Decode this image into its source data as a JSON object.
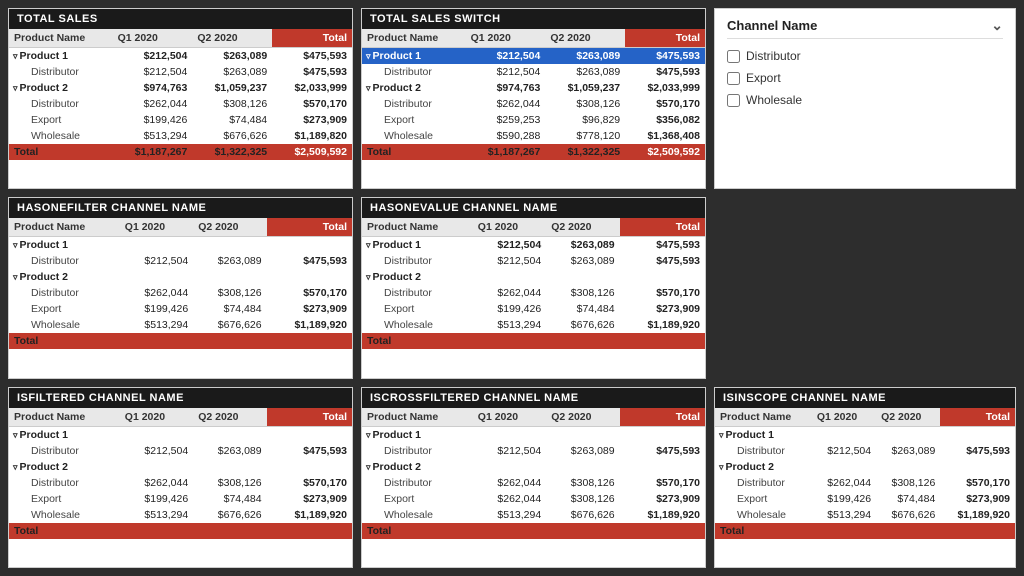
{
  "tables": {
    "totalSales": {
      "title": "TOTAL SALES",
      "columns": [
        "Product Name",
        "Q1 2020",
        "Q2 2020",
        "Total"
      ],
      "rows": [
        {
          "type": "product",
          "name": "Product 1",
          "q1": "$212,504",
          "q2": "$263,089",
          "total": "$475,593"
        },
        {
          "type": "child",
          "name": "Distributor",
          "q1": "$212,504",
          "q2": "$263,089",
          "total": "$475,593"
        },
        {
          "type": "product",
          "name": "Product 2",
          "q1": "$974,763",
          "q2": "$1,059,237",
          "total": "$2,033,999"
        },
        {
          "type": "child",
          "name": "Distributor",
          "q1": "$262,044",
          "q2": "$308,126",
          "total": "$570,170"
        },
        {
          "type": "child",
          "name": "Export",
          "q1": "$199,426",
          "q2": "$74,484",
          "total": "$273,909"
        },
        {
          "type": "child",
          "name": "Wholesale",
          "q1": "$513,294",
          "q2": "$676,626",
          "total": "$1,189,820"
        },
        {
          "type": "total",
          "name": "Total",
          "q1": "$1,187,267",
          "q2": "$1,322,325",
          "total": "$2,509,592"
        }
      ]
    },
    "totalSalesSwitch": {
      "title": "TOTAL SALES SWITCH",
      "columns": [
        "Product Name",
        "Q1 2020",
        "Q2 2020",
        "Total"
      ],
      "highlightRow": 0,
      "rows": [
        {
          "type": "product",
          "name": "Product 1",
          "q1": "$212,504",
          "q2": "$263,089",
          "total": "$475,593",
          "highlight": true
        },
        {
          "type": "child",
          "name": "Distributor",
          "q1": "$212,504",
          "q2": "$263,089",
          "total": "$475,593"
        },
        {
          "type": "product",
          "name": "Product 2",
          "q1": "$974,763",
          "q2": "$1,059,237",
          "total": "$2,033,999"
        },
        {
          "type": "child",
          "name": "Distributor",
          "q1": "$262,044",
          "q2": "$308,126",
          "total": "$570,170"
        },
        {
          "type": "child",
          "name": "Export",
          "q1": "$259,253",
          "q2": "$96,829",
          "total": "$356,082"
        },
        {
          "type": "child",
          "name": "Wholesale",
          "q1": "$590,288",
          "q2": "$778,120",
          "total": "$1,368,408"
        },
        {
          "type": "total",
          "name": "Total",
          "q1": "$1,187,267",
          "q2": "$1,322,325",
          "total": "$2,509,592"
        }
      ]
    },
    "hasOneFilter": {
      "title": "HASONEFILTER CHANNEL NAME",
      "columns": [
        "Product Name",
        "Q1 2020",
        "Q2 2020",
        "Total"
      ],
      "rows": [
        {
          "type": "product",
          "name": "Product 1",
          "q1": "",
          "q2": "",
          "total": ""
        },
        {
          "type": "child",
          "name": "Distributor",
          "q1": "$212,504",
          "q2": "$263,089",
          "total": "$475,593"
        },
        {
          "type": "product",
          "name": "Product 2",
          "q1": "",
          "q2": "",
          "total": ""
        },
        {
          "type": "child",
          "name": "Distributor",
          "q1": "$262,044",
          "q2": "$308,126",
          "total": "$570,170"
        },
        {
          "type": "child",
          "name": "Export",
          "q1": "$199,426",
          "q2": "$74,484",
          "total": "$273,909"
        },
        {
          "type": "child",
          "name": "Wholesale",
          "q1": "$513,294",
          "q2": "$676,626",
          "total": "$1,189,920"
        },
        {
          "type": "total",
          "name": "Total",
          "q1": "",
          "q2": "",
          "total": ""
        }
      ]
    },
    "hasOneValue": {
      "title": "HASONEVALUE CHANNEL NAME",
      "columns": [
        "Product Name",
        "Q1 2020",
        "Q2 2020",
        "Total"
      ],
      "rows": [
        {
          "type": "product",
          "name": "Product 1",
          "q1": "$212,504",
          "q2": "$263,089",
          "total": "$475,593"
        },
        {
          "type": "child",
          "name": "Distributor",
          "q1": "$212,504",
          "q2": "$263,089",
          "total": "$475,593"
        },
        {
          "type": "product",
          "name": "Product 2",
          "q1": "",
          "q2": "",
          "total": ""
        },
        {
          "type": "child",
          "name": "Distributor",
          "q1": "$262,044",
          "q2": "$308,126",
          "total": "$570,170"
        },
        {
          "type": "child",
          "name": "Export",
          "q1": "$199,426",
          "q2": "$74,484",
          "total": "$273,909"
        },
        {
          "type": "child",
          "name": "Wholesale",
          "q1": "$513,294",
          "q2": "$676,626",
          "total": "$1,189,920"
        },
        {
          "type": "total",
          "name": "Total",
          "q1": "",
          "q2": "",
          "total": ""
        }
      ]
    },
    "isFiltered": {
      "title": "ISFILTERED CHANNEL NAME",
      "columns": [
        "Product Name",
        "Q1 2020",
        "Q2 2020",
        "Total"
      ],
      "rows": [
        {
          "type": "product",
          "name": "Product 1",
          "q1": "",
          "q2": "",
          "total": ""
        },
        {
          "type": "child",
          "name": "Distributor",
          "q1": "$212,504",
          "q2": "$263,089",
          "total": "$475,593"
        },
        {
          "type": "product",
          "name": "Product 2",
          "q1": "",
          "q2": "",
          "total": ""
        },
        {
          "type": "child",
          "name": "Distributor",
          "q1": "$262,044",
          "q2": "$308,126",
          "total": "$570,170"
        },
        {
          "type": "child",
          "name": "Export",
          "q1": "$199,426",
          "q2": "$74,484",
          "total": "$273,909"
        },
        {
          "type": "child",
          "name": "Wholesale",
          "q1": "$513,294",
          "q2": "$676,626",
          "total": "$1,189,920"
        },
        {
          "type": "total",
          "name": "Total",
          "q1": "",
          "q2": "",
          "total": ""
        }
      ]
    },
    "isCrossFiltered": {
      "title": "ISCROSSFILTERED CHANNEL NAME",
      "columns": [
        "Product Name",
        "Q1 2020",
        "Q2 2020",
        "Total"
      ],
      "rows": [
        {
          "type": "product",
          "name": "Product 1",
          "q1": "",
          "q2": "",
          "total": ""
        },
        {
          "type": "child",
          "name": "Distributor",
          "q1": "$212,504",
          "q2": "$263,089",
          "total": "$475,593"
        },
        {
          "type": "product",
          "name": "Product 2",
          "q1": "",
          "q2": "",
          "total": ""
        },
        {
          "type": "child",
          "name": "Distributor",
          "q1": "$262,044",
          "q2": "$308,126",
          "total": "$570,170"
        },
        {
          "type": "child",
          "name": "Export",
          "q1": "$262,044",
          "q2": "$308,126",
          "total": "$273,909"
        },
        {
          "type": "child",
          "name": "Wholesale",
          "q1": "$513,294",
          "q2": "$676,626",
          "total": "$1,189,920"
        },
        {
          "type": "total",
          "name": "Total",
          "q1": "",
          "q2": "",
          "total": ""
        }
      ]
    },
    "isInScope": {
      "title": "ISINSCOPE CHANNEL NAME",
      "columns": [
        "Product Name",
        "Q1 2020",
        "Q2 2020",
        "Total"
      ],
      "rows": [
        {
          "type": "product",
          "name": "Product 1",
          "q1": "",
          "q2": "",
          "total": ""
        },
        {
          "type": "child",
          "name": "Distributor",
          "q1": "$212,504",
          "q2": "$263,089",
          "total": "$475,593"
        },
        {
          "type": "product",
          "name": "Product 2",
          "q1": "",
          "q2": "",
          "total": ""
        },
        {
          "type": "child",
          "name": "Distributor",
          "q1": "$262,044",
          "q2": "$308,126",
          "total": "$570,170"
        },
        {
          "type": "child",
          "name": "Export",
          "q1": "$199,426",
          "q2": "$74,484",
          "total": "$273,909"
        },
        {
          "type": "child",
          "name": "Wholesale",
          "q1": "$513,294",
          "q2": "$676,626",
          "total": "$1,189,920"
        },
        {
          "type": "total",
          "name": "Total",
          "q1": "",
          "q2": "",
          "total": ""
        }
      ]
    }
  },
  "slicer": {
    "title": "Channel Name",
    "items": [
      "Distributor",
      "Export",
      "Wholesale"
    ]
  },
  "colors": {
    "headerBg": "#1a1a1a",
    "totalRowBg": "#c0392b",
    "highlightBlueBg": "#2563c7",
    "tableHeaderBg": "#e8e8e8"
  }
}
